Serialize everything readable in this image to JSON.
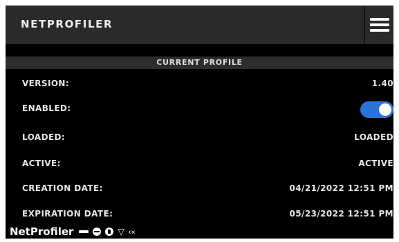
{
  "header": {
    "title": "NETPROFILER"
  },
  "section": {
    "title": "CURRENT PROFILE"
  },
  "rows": [
    {
      "label": "VERSION:",
      "value": "1.40"
    },
    {
      "label": "ENABLED:",
      "toggle_on": true
    },
    {
      "label": "LOADED:",
      "value": "LOADED"
    },
    {
      "label": "ACTIVE:",
      "value": "ACTIVE"
    },
    {
      "label": "CREATION DATE:",
      "value": "04/21/2022 12:51 PM"
    },
    {
      "label": "EXPIRATION DATE:",
      "value": "05/23/2022 12:51 PM"
    }
  ],
  "footer": {
    "label": "NetProfiler",
    "icons": [
      "ethernet-icon",
      "globe-icon",
      "compass-icon",
      "wifi-icon",
      "usb-icon"
    ]
  },
  "colors": {
    "toggle_accent": "#2a74d9",
    "header_bg": "#2a2a2a",
    "section_bg": "#2d2d2d"
  }
}
